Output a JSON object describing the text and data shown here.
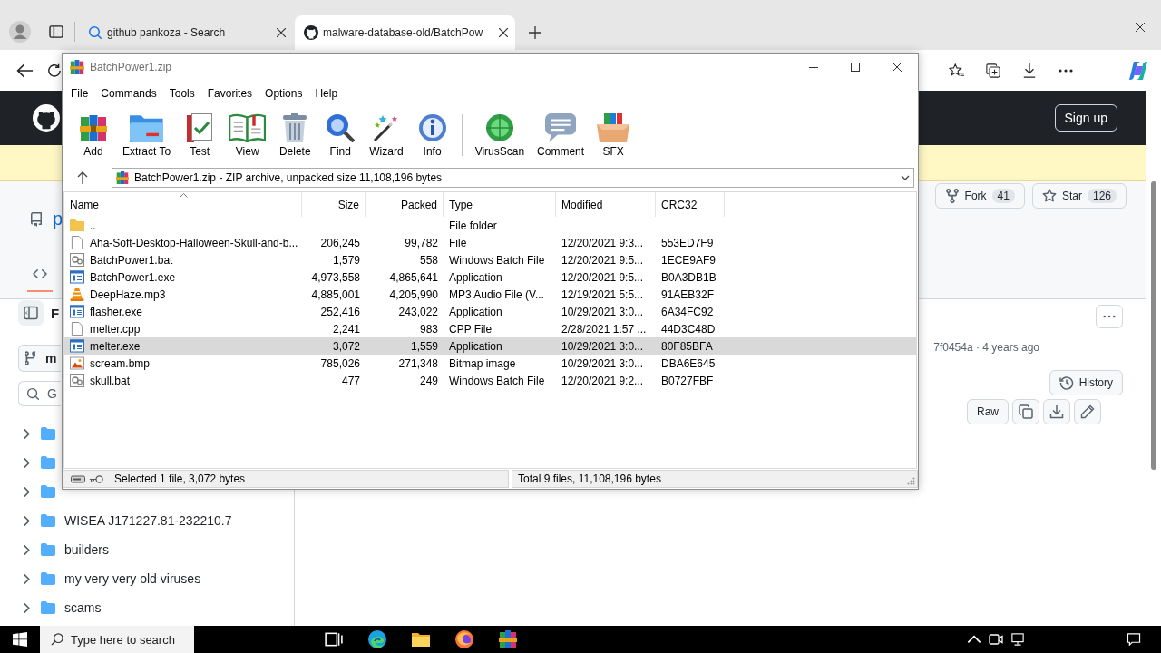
{
  "browser": {
    "tabs": [
      {
        "kind": "search",
        "title": "github pankoza - Search",
        "selected": false
      },
      {
        "kind": "github",
        "title": "malware-database-old/BatchPow",
        "selected": true
      }
    ]
  },
  "page": {
    "header": {
      "signup": "Sign up"
    },
    "repo": {
      "owner": "p",
      "fork": {
        "label": "Fork",
        "count": "41"
      },
      "star": {
        "label": "Star",
        "count": "126"
      }
    },
    "code_tab": {
      "selected": true
    },
    "sidebar": {
      "title": "F",
      "branch": "m",
      "search": {
        "placeholder": "G"
      },
      "tree": [
        {
          "expanded": false
        },
        {
          "expanded": false
        },
        {
          "expanded": false
        },
        {
          "name": "WISEA J171227.81-232210.7",
          "expanded": false
        },
        {
          "name": "builders",
          "expanded": false
        },
        {
          "name": "my very very old viruses",
          "expanded": false
        },
        {
          "name": "scams",
          "expanded": false
        }
      ]
    },
    "file_header": {
      "commit": "7f0454a · 4 years ago",
      "history": "History",
      "raw": "Raw"
    }
  },
  "winrar": {
    "title": "BatchPower1.zip",
    "menu": [
      "File",
      "Commands",
      "Tools",
      "Favorites",
      "Options",
      "Help"
    ],
    "toolbar": [
      {
        "kind": "add",
        "label": "Add"
      },
      {
        "kind": "extract",
        "label": "Extract To"
      },
      {
        "kind": "test",
        "label": "Test"
      },
      {
        "kind": "view",
        "label": "View"
      },
      {
        "kind": "delete",
        "label": "Delete"
      },
      {
        "kind": "find",
        "label": "Find"
      },
      {
        "kind": "wizard",
        "label": "Wizard"
      },
      {
        "kind": "info",
        "label": "Info"
      },
      {
        "kind": "virusscan",
        "label": "VirusScan"
      },
      {
        "kind": "comment",
        "label": "Comment"
      },
      {
        "kind": "sfx",
        "label": "SFX"
      }
    ],
    "path": "BatchPower1.zip - ZIP archive, unpacked size 11,108,196 bytes",
    "columns": [
      {
        "label": "Name",
        "sorted": true
      },
      {
        "label": "Size",
        "sorted": false
      },
      {
        "label": "Packed",
        "sorted": false
      },
      {
        "label": "Type",
        "sorted": false
      },
      {
        "label": "Modified",
        "sorted": false
      },
      {
        "label": "CRC32",
        "sorted": false
      }
    ],
    "rows": [
      {
        "kind": "folder",
        "name": "..",
        "type": "File folder",
        "selected": false
      },
      {
        "kind": "file",
        "name": "Aha-Soft-Desktop-Halloween-Skull-and-b...",
        "size": "206,245",
        "packed": "99,782",
        "type": "File",
        "modified": "12/20/2021 9:3...",
        "crc": "553ED7F9",
        "selected": false
      },
      {
        "kind": "batch",
        "name": "BatchPower1.bat",
        "size": "1,579",
        "packed": "558",
        "type": "Windows Batch File",
        "modified": "12/20/2021 9:5...",
        "crc": "1ECE9AF9",
        "selected": false
      },
      {
        "kind": "exe",
        "name": "BatchPower1.exe",
        "size": "4,973,558",
        "packed": "4,865,641",
        "type": "Application",
        "modified": "12/20/2021 9:5...",
        "crc": "B0A3DB1B",
        "selected": false
      },
      {
        "kind": "audio",
        "name": "DeepHaze.mp3",
        "size": "4,885,001",
        "packed": "4,205,990",
        "type": "MP3 Audio File (V...",
        "modified": "12/19/2021 5:5...",
        "crc": "91AEB32F",
        "selected": false
      },
      {
        "kind": "exe",
        "name": "flasher.exe",
        "size": "252,416",
        "packed": "243,022",
        "type": "Application",
        "modified": "10/29/2021 3:0...",
        "crc": "6A34FC92",
        "selected": false
      },
      {
        "kind": "file",
        "name": "melter.cpp",
        "size": "2,241",
        "packed": "983",
        "type": "CPP File",
        "modified": "2/28/2021 1:57 ...",
        "crc": "44D3C48D",
        "selected": false
      },
      {
        "kind": "exe",
        "name": "melter.exe",
        "size": "3,072",
        "packed": "1,559",
        "type": "Application",
        "modified": "10/29/2021 3:0...",
        "crc": "80F85BFA",
        "selected": true
      },
      {
        "kind": "bitmap",
        "name": "scream.bmp",
        "size": "785,026",
        "packed": "271,348",
        "type": "Bitmap image",
        "modified": "10/29/2021 3:0...",
        "crc": "DBA6E645",
        "selected": false
      },
      {
        "kind": "batch",
        "name": "skull.bat",
        "size": "477",
        "packed": "249",
        "type": "Windows Batch File",
        "modified": "12/20/2021 9:2...",
        "crc": "B0727FBF",
        "selected": false
      }
    ],
    "status": {
      "selection": "Selected 1 file, 3,072 bytes",
      "total": "Total 9 files, 11,108,196 bytes"
    }
  },
  "taskbar": {
    "search": {
      "placeholder": "Type here to search"
    },
    "apps": [
      {
        "kind": "taskview"
      },
      {
        "kind": "edge"
      },
      {
        "kind": "explorer"
      },
      {
        "kind": "firefox"
      },
      {
        "kind": "winrar"
      }
    ]
  }
}
